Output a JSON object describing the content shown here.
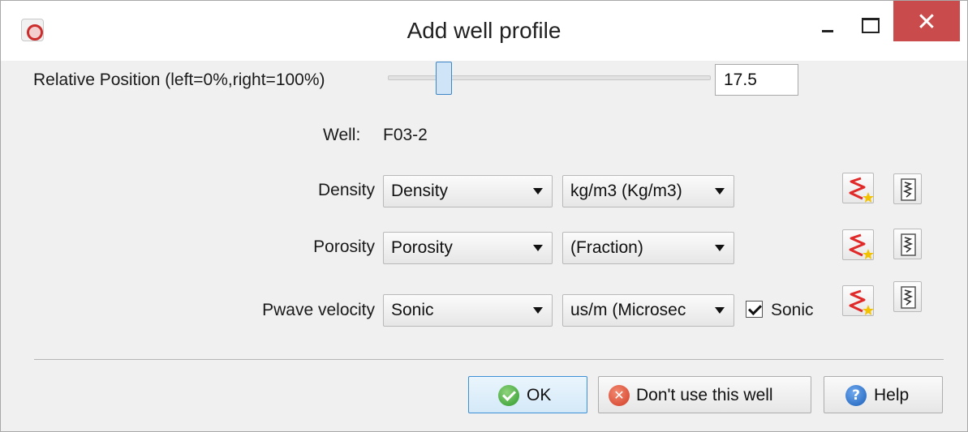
{
  "window": {
    "title": "Add well profile",
    "close_glyph": "✕",
    "icons": {
      "app": "app-logo-icon",
      "minimize": "minimize-icon",
      "maximize": "maximize-icon",
      "close": "close-icon"
    }
  },
  "position": {
    "label": "Relative Position (left=0%,right=100%)",
    "value": "17.5",
    "slider_percent": 17.5
  },
  "well": {
    "label": "Well:",
    "name": "F03-2"
  },
  "rows": [
    {
      "label": "Density",
      "log": "Density",
      "unit": "kg/m3 (Kg/m3)"
    },
    {
      "label": "Porosity",
      "log": "Porosity",
      "unit": "(Fraction)"
    },
    {
      "label": "Pwave velocity",
      "log": "Sonic",
      "unit": "us/m (Microsec",
      "checkbox_label": "Sonic",
      "checkbox_checked": true
    }
  ],
  "row_icons": {
    "create": "create-log-icon",
    "view": "log-viewer-icon"
  },
  "buttons": {
    "ok": "OK",
    "dont_use": "Don't use this well",
    "help": "Help",
    "x_glyph": "✕",
    "help_glyph": "?"
  },
  "colors": {
    "close_button": "#c94b4b",
    "default_button_border": "#3d8fd6",
    "create_icon_red": "#e02a2a",
    "create_icon_star": "#f2c200"
  }
}
